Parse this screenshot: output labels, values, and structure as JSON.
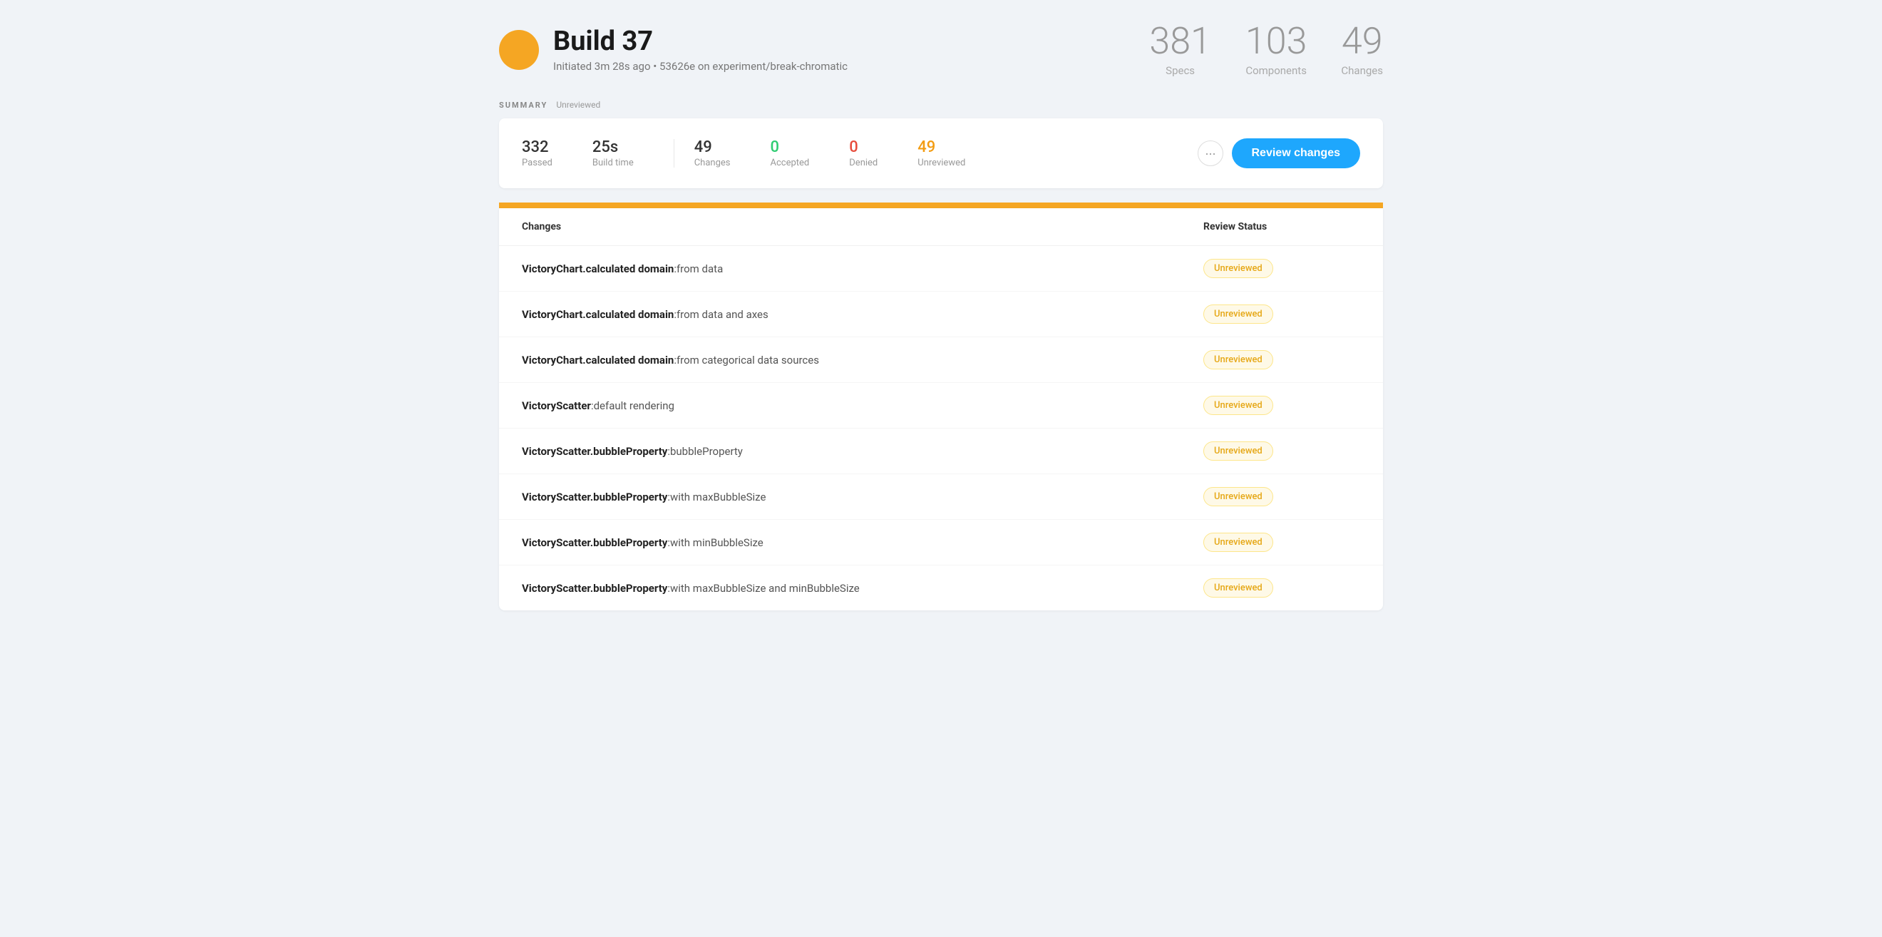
{
  "header": {
    "build_icon_alt": "build-status-icon",
    "build_title": "Build 37",
    "build_subtitle": "Initiated 3m 28s ago • 53626e on experiment/break-chromatic",
    "stats": [
      {
        "number": "381",
        "label": "Specs"
      },
      {
        "number": "103",
        "label": "Components"
      },
      {
        "number": "49",
        "label": "Changes"
      }
    ]
  },
  "summary": {
    "section_title": "SUMMARY",
    "section_badge": "Unreviewed",
    "stats": [
      {
        "number": "332",
        "label": "Passed",
        "color": "normal"
      },
      {
        "number": "25s",
        "label": "Build time",
        "color": "normal"
      },
      {
        "number": "49",
        "label": "Changes",
        "color": "normal"
      },
      {
        "number": "0",
        "label": "Accepted",
        "color": "green"
      },
      {
        "number": "0",
        "label": "Denied",
        "color": "red"
      },
      {
        "number": "49",
        "label": "Unreviewed",
        "color": "orange"
      }
    ],
    "more_button_label": "···",
    "review_button_label": "Review changes"
  },
  "table": {
    "col_changes": "Changes",
    "col_status": "Review Status",
    "rows": [
      {
        "bold": "VictoryChart.calculated domain",
        "normal": ":from data",
        "status": "Unreviewed"
      },
      {
        "bold": "VictoryChart.calculated domain",
        "normal": ":from data and axes",
        "status": "Unreviewed"
      },
      {
        "bold": "VictoryChart.calculated domain",
        "normal": ":from categorical data sources",
        "status": "Unreviewed"
      },
      {
        "bold": "VictoryScatter",
        "normal": ":default rendering",
        "status": "Unreviewed"
      },
      {
        "bold": "VictoryScatter.bubbleProperty",
        "normal": ":bubbleProperty",
        "status": "Unreviewed"
      },
      {
        "bold": "VictoryScatter.bubbleProperty",
        "normal": ":with maxBubbleSize",
        "status": "Unreviewed"
      },
      {
        "bold": "VictoryScatter.bubbleProperty",
        "normal": ":with minBubbleSize",
        "status": "Unreviewed"
      },
      {
        "bold": "VictoryScatter.bubbleProperty",
        "normal": ":with maxBubbleSize and minBubbleSize",
        "status": "Unreviewed"
      }
    ]
  }
}
